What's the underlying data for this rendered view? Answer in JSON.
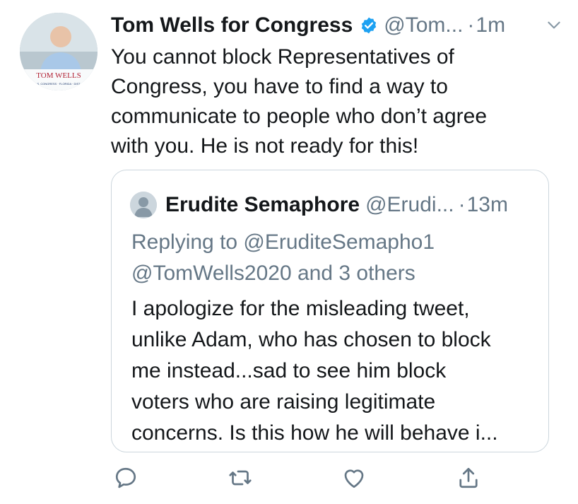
{
  "tweet": {
    "display_name": "Tom Wells for Congress",
    "handle": "@Tom...",
    "dot": "·",
    "time": "1m",
    "text": "You cannot block Representatives of\nCongress, you have to find a way to\ncommunicate to people who don’t agree\nwith you. He is not ready for this!",
    "avatar_logo_text": "TOM WELLS",
    "avatar_sub_text": "U.S. CONGRESS · FLORIDA · DIST. 3"
  },
  "quote": {
    "display_name": "Erudite Semaphore",
    "handle": "@Erudi...",
    "dot": "·",
    "time": "13m",
    "replying": "Replying to @EruditeSemapho1\n@TomWells2020 and 3 others",
    "text": "I apologize for the misleading tweet,\nunlike Adam, who has chosen to block\nme instead...sad to see him block\nvoters who are raising legitimate\nconcerns. Is this how he will behave i..."
  },
  "colors": {
    "accent": "#1da1f2",
    "secondary_text": "#657786",
    "border": "#ccd6dd"
  },
  "icons": [
    "verified-badge-icon",
    "chevron-down-icon",
    "reply-icon",
    "retweet-icon",
    "like-icon",
    "share-icon"
  ]
}
